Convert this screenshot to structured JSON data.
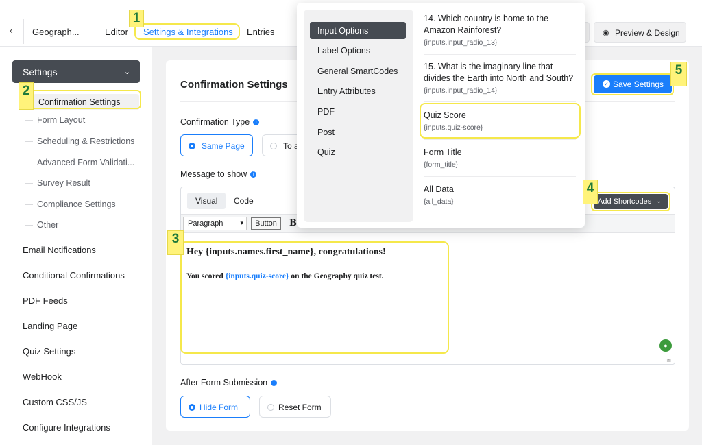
{
  "topbar": {
    "back_icon": "chevron-left",
    "form_name": "Geograph...",
    "tabs": [
      {
        "label": "Editor"
      },
      {
        "label": "Settings & Integrations",
        "active": true
      },
      {
        "label": "Entries"
      }
    ],
    "preview_label": "Preview & Design"
  },
  "sidebar": {
    "dropdown_label": "Settings",
    "sub_items": [
      {
        "label": "Confirmation Settings",
        "active": true
      },
      {
        "label": "Form Layout"
      },
      {
        "label": "Scheduling & Restrictions"
      },
      {
        "label": "Advanced Form Validati..."
      },
      {
        "label": "Survey Result"
      },
      {
        "label": "Compliance Settings"
      },
      {
        "label": "Other"
      }
    ],
    "main_items": [
      {
        "label": "Email Notifications"
      },
      {
        "label": "Conditional Confirmations"
      },
      {
        "label": "PDF Feeds"
      },
      {
        "label": "Landing Page"
      },
      {
        "label": "Quiz Settings"
      },
      {
        "label": "WebHook"
      },
      {
        "label": "Custom CSS/JS"
      },
      {
        "label": "Configure Integrations"
      }
    ]
  },
  "main": {
    "title": "Confirmation Settings",
    "save_label": "Save Settings",
    "confirmation_type_label": "Confirmation Type",
    "confirmation_options": [
      {
        "label": "Same Page",
        "selected": true
      },
      {
        "label": "To a"
      }
    ],
    "message_label": "Message to show",
    "editor": {
      "tabs": [
        {
          "label": "Visual",
          "active": true
        },
        {
          "label": "Code"
        }
      ],
      "paragraph_select": "Paragraph",
      "button_label": "Button",
      "bold_label": "B",
      "add_shortcodes_label": "Add Shortcodes",
      "content_heading": "Hey {inputs.names.first_name}, congratulations!",
      "content_para_before": "You scored ",
      "content_para_code": "{inputs.quiz-score}",
      "content_para_after": " on the Geography quiz test."
    },
    "after_submission_label": "After Form Submission",
    "after_submission_options": [
      {
        "label": "Hide Form",
        "selected": true
      },
      {
        "label": "Reset Form"
      }
    ]
  },
  "shortcode_dropdown": {
    "categories": [
      {
        "label": "Input Options",
        "active": true
      },
      {
        "label": "Label Options"
      },
      {
        "label": "General SmartCodes"
      },
      {
        "label": "Entry Attributes"
      },
      {
        "label": "PDF"
      },
      {
        "label": "Post"
      },
      {
        "label": "Quiz"
      }
    ],
    "items": [
      {
        "title": "14. Which country is home to the Amazon Rainforest?",
        "code": "{inputs.input_radio_13}"
      },
      {
        "title": "15. What is the imaginary line that divides the Earth into North and South?",
        "code": "{inputs.input_radio_14}"
      },
      {
        "title": "Quiz Score",
        "code": "{inputs.quiz-score}"
      },
      {
        "title": "Form Title",
        "code": "{form_title}"
      },
      {
        "title": "All Data",
        "code": "{all_data}"
      }
    ]
  },
  "annotations": {
    "badges": [
      "1",
      "2",
      "3",
      "4",
      "5"
    ],
    "highlight_color": "#f5e84b"
  },
  "colors": {
    "accent": "#1a7efb",
    "dark": "#464b52"
  }
}
